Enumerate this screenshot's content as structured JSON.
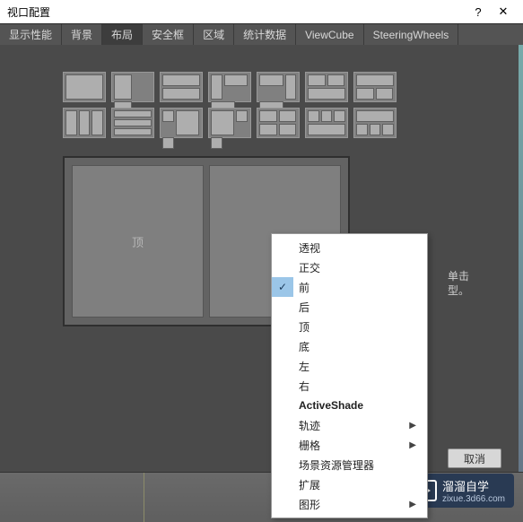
{
  "titlebar": {
    "title": "视口配置",
    "help": "?",
    "close": "✕"
  },
  "tabs": [
    {
      "label": "显示性能"
    },
    {
      "label": "背景"
    },
    {
      "label": "布局",
      "active": true
    },
    {
      "label": "安全框"
    },
    {
      "label": "区域"
    },
    {
      "label": "统计数据"
    },
    {
      "label": "ViewCube"
    },
    {
      "label": "SteeringWheels"
    }
  ],
  "preview": {
    "left_label": "顶",
    "right_label": ""
  },
  "hint": {
    "line1": "单击",
    "line2": "型。"
  },
  "context_menu": [
    {
      "label": "透视"
    },
    {
      "label": "正交"
    },
    {
      "label": "前",
      "checked": true
    },
    {
      "label": "后"
    },
    {
      "label": "顶"
    },
    {
      "label": "底"
    },
    {
      "label": "左"
    },
    {
      "label": "右"
    },
    {
      "label": "ActiveShade",
      "bold": true
    },
    {
      "label": "轨迹",
      "submenu": true
    },
    {
      "label": "栅格",
      "submenu": true
    },
    {
      "label": "场景资源管理器"
    },
    {
      "label": "扩展"
    },
    {
      "label": "图形",
      "submenu": true
    }
  ],
  "footer": {
    "cancel": "取消"
  },
  "watermark": {
    "brand": "溜溜自学",
    "url": "zixue.3d66.com"
  }
}
